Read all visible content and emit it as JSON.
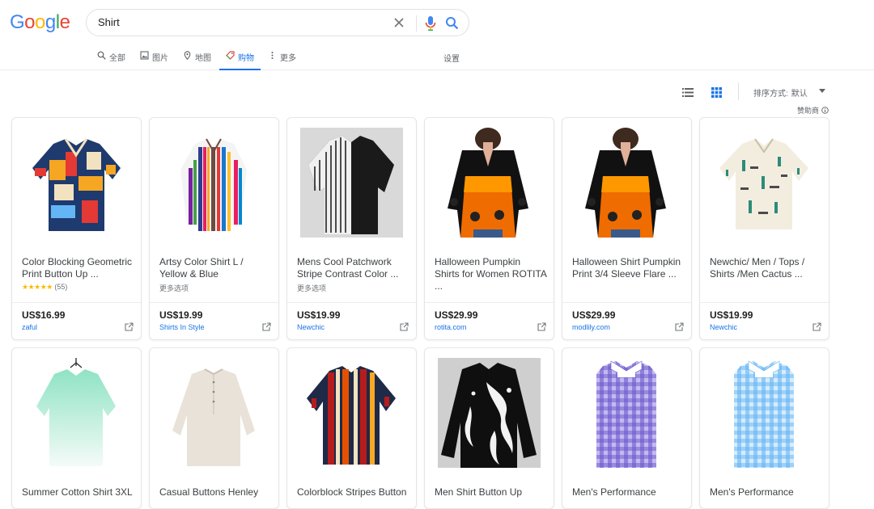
{
  "logo": {
    "letters": [
      {
        "ch": "G",
        "color": "#4285F4"
      },
      {
        "ch": "o",
        "color": "#EA4335"
      },
      {
        "ch": "o",
        "color": "#FBBC05"
      },
      {
        "ch": "g",
        "color": "#4285F4"
      },
      {
        "ch": "l",
        "color": "#34A853"
      },
      {
        "ch": "e",
        "color": "#EA4335"
      }
    ]
  },
  "search": {
    "value": "Shirt"
  },
  "tabs": [
    {
      "label": "全部",
      "icon": "search-icon"
    },
    {
      "label": "图片",
      "icon": "image-icon"
    },
    {
      "label": "地图",
      "icon": "map-pin-icon"
    },
    {
      "label": "购物",
      "icon": "tag-icon",
      "active": true
    },
    {
      "label": "更多",
      "icon": "more-vert-icon"
    }
  ],
  "settings_label": "设置",
  "toolbar": {
    "sort_label": "排序方式:",
    "sort_value": "默认",
    "sponsored": "赞助商"
  },
  "products": [
    {
      "title": "Color Blocking Geometric Print Button Up ...",
      "stars": "★★★★★",
      "reviews": "(55)",
      "price": "US$16.99",
      "merchant": "zaful",
      "image": "shirt-colorblock-geometric"
    },
    {
      "title": "Artsy Color Shirt L / Yellow & Blue",
      "more": "更多选项",
      "price": "US$19.99",
      "merchant": "Shirts In Style",
      "image": "shirt-artsy-stripes"
    },
    {
      "title": "Mens Cool Patchwork Stripe Contrast Color ...",
      "more": "更多选项",
      "price": "US$19.99",
      "merchant": "Newchic",
      "image": "shirt-patchwork-stripe"
    },
    {
      "title": "Halloween Pumpkin Shirts for Women ROTITA ...",
      "price": "US$29.99",
      "merchant": "rotita.com",
      "image": "blouse-halloween-pumpkin"
    },
    {
      "title": "Halloween Shirt Pumpkin Print 3/4 Sleeve Flare ...",
      "price": "US$29.99",
      "merchant": "modlily.com",
      "image": "blouse-halloween-flare"
    },
    {
      "title": "Newchic/ Men / Tops / Shirts /Men Cactus ...",
      "price": "US$19.99",
      "merchant": "Newchic",
      "image": "shirt-cactus-print"
    },
    {
      "title": "Summer Cotton Shirt 3XL",
      "image": "shirt-green-gradient"
    },
    {
      "title": "Casual Buttons Henley",
      "image": "shirt-linen-henley"
    },
    {
      "title": "Colorblock Stripes Button",
      "image": "shirt-colorblock-stripes"
    },
    {
      "title": "Men Shirt Button Up",
      "image": "shirt-octopus-print"
    },
    {
      "title": "Men's Performance",
      "image": "shirt-purple-gingham"
    },
    {
      "title": "Men's Performance",
      "image": "shirt-blue-gingham"
    }
  ],
  "colors": {
    "accent": "#1a73e8",
    "text_secondary": "#5f6368",
    "star": "#fbbc04"
  }
}
